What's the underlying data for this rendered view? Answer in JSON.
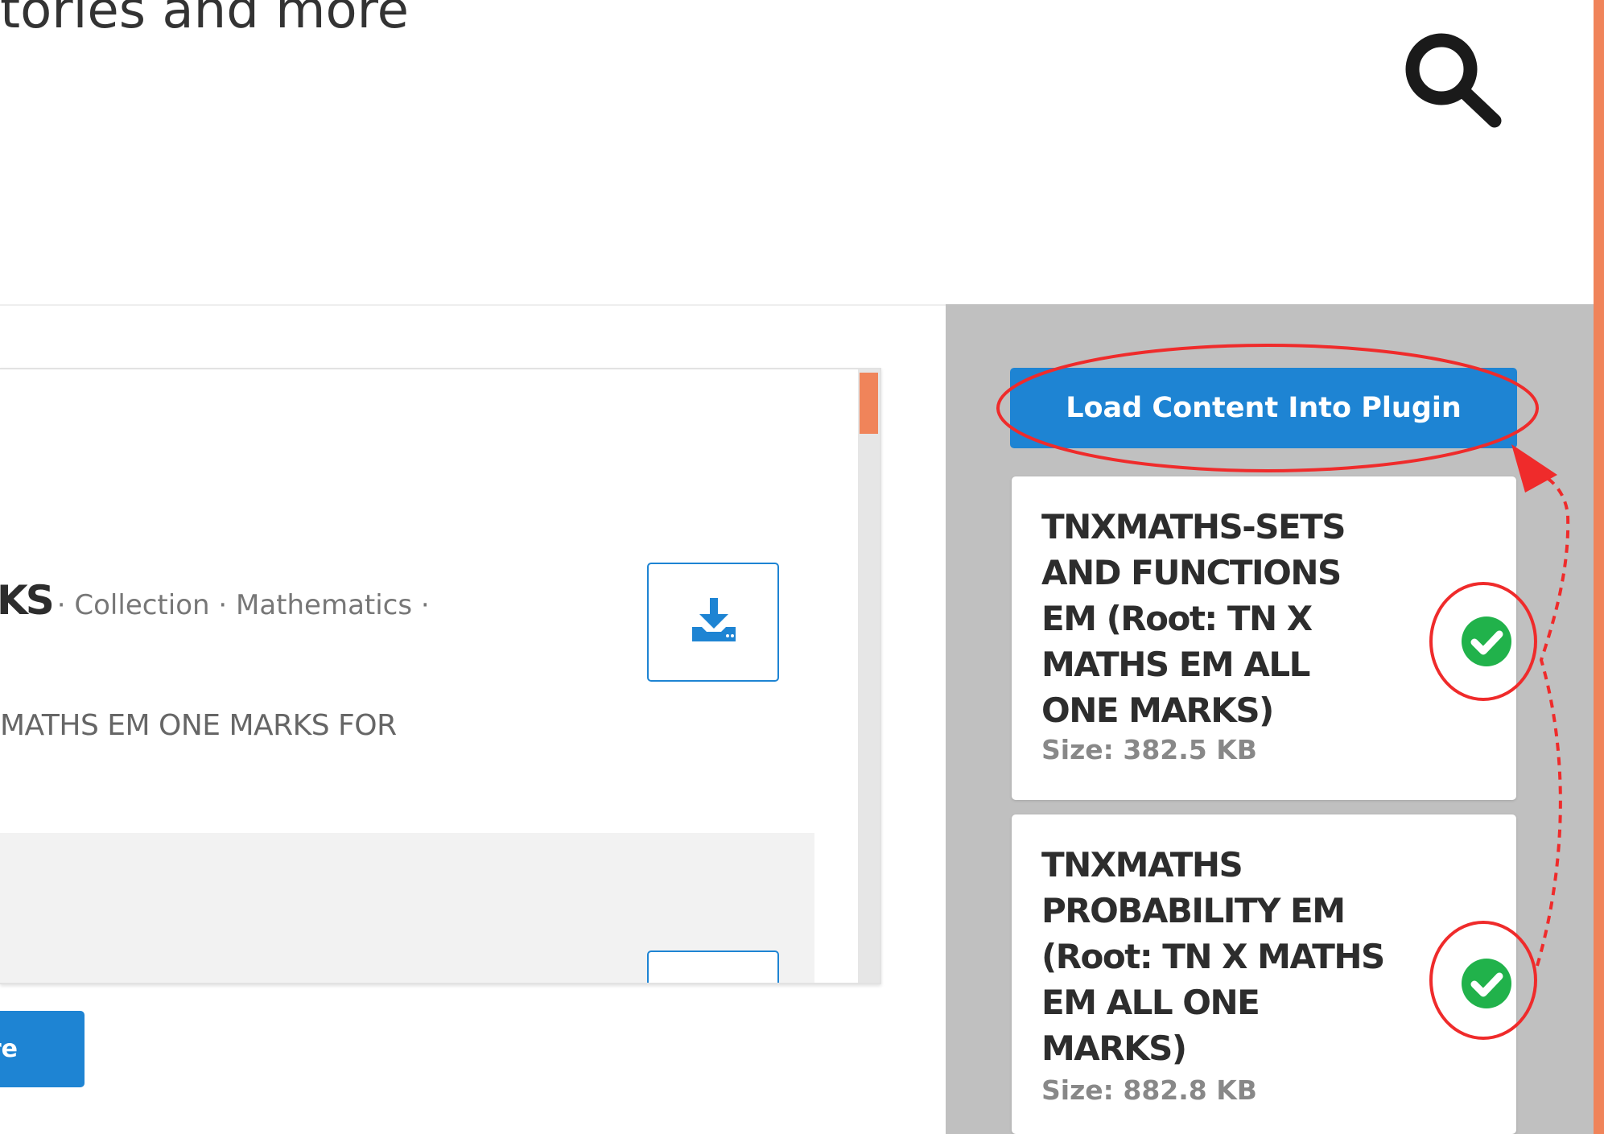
{
  "header": {
    "tagline_fragment": "tories and more"
  },
  "content_card": {
    "title_fragment": "KS",
    "meta": "· Collection · Mathematics ·",
    "description_fragment": "MATHS EM ONE MARKS FOR"
  },
  "more_button": {
    "label_fragment": "re"
  },
  "plugin_panel": {
    "load_button_label": "Load Content Into Plugin",
    "items": [
      {
        "title": "TNXMATHS-SETS AND FUNCTIONS EM (Root: TN X MATHS EM ALL ONE MARKS)",
        "size": "Size: 382.5 KB",
        "status": "check-circle-icon"
      },
      {
        "title": "TNXMATHS PROBABILITY EM (Root: TN X MATHS EM ALL ONE MARKS)",
        "size": "Size: 882.8 KB",
        "status": "check-circle-icon"
      }
    ]
  },
  "colors": {
    "primary_blue": "#1e84d3",
    "accent_orange": "#f0845a",
    "panel_grey": "#c0c0c0",
    "success_green": "#21b24b",
    "annotation_red": "#ef2b2b"
  }
}
